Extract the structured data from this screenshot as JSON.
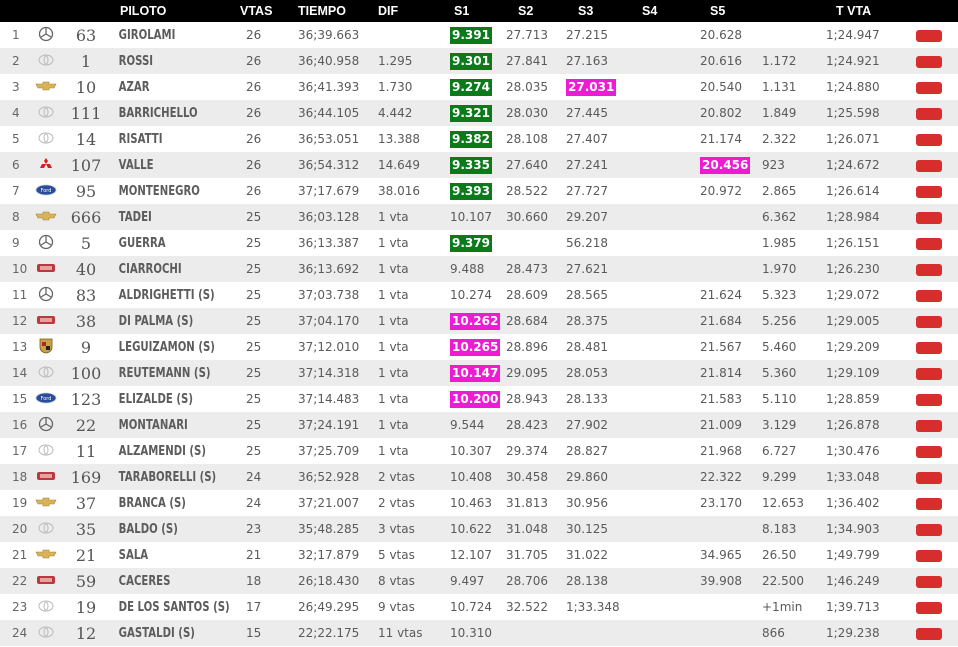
{
  "table": {
    "headers": {
      "piloto": "PILOTO",
      "vtas": "VTAS",
      "tiempo": "TIEMPO",
      "dif": "DIF",
      "s1": "S1",
      "s2": "S2",
      "s3": "S3",
      "s4": "S4",
      "s5": "S5",
      "tvta": "T VTA"
    },
    "rows": [
      {
        "pos": "1",
        "brand": "mercedes",
        "num": "63",
        "pilot": "GIROLAMI",
        "laps": "26",
        "time": "36;39.663",
        "dif": "",
        "s1": "9.391",
        "s1_hl": "green",
        "s2": "27.713",
        "s2_hl": "",
        "s3": "27.215",
        "s3_hl": "",
        "s4": "",
        "s5": "20.628",
        "s5_hl": "",
        "gap": "",
        "tvta": "1;24.947"
      },
      {
        "pos": "2",
        "brand": "toyota",
        "num": "1",
        "pilot": "ROSSI",
        "laps": "26",
        "time": "36;40.958",
        "dif": "1.295",
        "s1": "9.301",
        "s1_hl": "green",
        "s2": "27.841",
        "s2_hl": "",
        "s3": "27.163",
        "s3_hl": "",
        "s4": "",
        "s5": "20.616",
        "s5_hl": "",
        "gap": "1.172",
        "tvta": "1;24.921"
      },
      {
        "pos": "3",
        "brand": "chevrolet",
        "num": "10",
        "pilot": "AZAR",
        "laps": "26",
        "time": "36;41.393",
        "dif": "1.730",
        "s1": "9.274",
        "s1_hl": "green",
        "s2": "28.035",
        "s2_hl": "",
        "s3": "27.031",
        "s3_hl": "pink",
        "s4": "",
        "s5": "20.540",
        "s5_hl": "",
        "gap": "1.131",
        "tvta": "1;24.880"
      },
      {
        "pos": "4",
        "brand": "toyota",
        "num": "111",
        "pilot": "BARRICHELLO",
        "laps": "26",
        "time": "36;44.105",
        "dif": "4.442",
        "s1": "9.321",
        "s1_hl": "green",
        "s2": "28.030",
        "s2_hl": "",
        "s3": "27.445",
        "s3_hl": "",
        "s4": "",
        "s5": "20.802",
        "s5_hl": "",
        "gap": "1.849",
        "tvta": "1;25.598"
      },
      {
        "pos": "5",
        "brand": "toyota",
        "num": "14",
        "pilot": "RISATTI",
        "laps": "26",
        "time": "36;53.051",
        "dif": "13.388",
        "s1": "9.382",
        "s1_hl": "green",
        "s2": "28.108",
        "s2_hl": "",
        "s3": "27.407",
        "s3_hl": "",
        "s4": "",
        "s5": "21.174",
        "s5_hl": "",
        "gap": "2.322",
        "tvta": "1;26.071"
      },
      {
        "pos": "6",
        "brand": "mitsubishi",
        "num": "107",
        "pilot": "VALLE",
        "laps": "26",
        "time": "36;54.312",
        "dif": "14.649",
        "s1": "9.335",
        "s1_hl": "green",
        "s2": "27.640",
        "s2_hl": "",
        "s3": "27.241",
        "s3_hl": "",
        "s4": "",
        "s5": "20.456",
        "s5_hl": "pink",
        "gap": "923",
        "tvta": "1;24.672"
      },
      {
        "pos": "7",
        "brand": "ford",
        "num": "95",
        "pilot": "MONTENEGRO",
        "laps": "26",
        "time": "37;17.679",
        "dif": "38.016",
        "s1": "9.393",
        "s1_hl": "green",
        "s2": "28.522",
        "s2_hl": "",
        "s3": "27.727",
        "s3_hl": "",
        "s4": "",
        "s5": "20.972",
        "s5_hl": "",
        "gap": "2.865",
        "tvta": "1;26.614"
      },
      {
        "pos": "8",
        "brand": "chevrolet",
        "num": "666",
        "pilot": "TADEI",
        "laps": "25",
        "time": "36;03.128",
        "dif": "1 vta",
        "s1": "10.107",
        "s1_hl": "",
        "s2": "30.660",
        "s2_hl": "",
        "s3": "29.207",
        "s3_hl": "",
        "s4": "",
        "s5": "",
        "s5_hl": "",
        "gap": "6.362",
        "tvta": "1;28.984"
      },
      {
        "pos": "9",
        "brand": "mercedes",
        "num": "5",
        "pilot": "GUERRA",
        "laps": "25",
        "time": "36;13.387",
        "dif": "1 vta",
        "s1": "9.379",
        "s1_hl": "green",
        "s2": "",
        "s2_hl": "",
        "s3": "56.218",
        "s3_hl": "",
        "s4": "",
        "s5": "",
        "s5_hl": "",
        "gap": "1.985",
        "tvta": "1;26.151"
      },
      {
        "pos": "10",
        "brand": "dodge",
        "num": "40",
        "pilot": "CIARROCHI",
        "laps": "25",
        "time": "36;13.692",
        "dif": "1 vta",
        "s1": "9.488",
        "s1_hl": "",
        "s2": "28.473",
        "s2_hl": "",
        "s3": "27.621",
        "s3_hl": "",
        "s4": "",
        "s5": "",
        "s5_hl": "",
        "gap": "1.970",
        "tvta": "1;26.230"
      },
      {
        "pos": "11",
        "brand": "mercedes",
        "num": "83",
        "pilot": "ALDRIGHETTI (S)",
        "laps": "25",
        "time": "37;03.738",
        "dif": "1 vta",
        "s1": "10.274",
        "s1_hl": "",
        "s2": "28.609",
        "s2_hl": "",
        "s3": "28.565",
        "s3_hl": "",
        "s4": "",
        "s5": "21.624",
        "s5_hl": "",
        "gap": "5.323",
        "tvta": "1;29.072"
      },
      {
        "pos": "12",
        "brand": "dodge",
        "num": "38",
        "pilot": "DI PALMA (S)",
        "laps": "25",
        "time": "37;04.170",
        "dif": "1 vta",
        "s1": "10.262",
        "s1_hl": "pink",
        "s2": "28.684",
        "s2_hl": "",
        "s3": "28.375",
        "s3_hl": "",
        "s4": "",
        "s5": "21.684",
        "s5_hl": "",
        "gap": "5.256",
        "tvta": "1;29.005"
      },
      {
        "pos": "13",
        "brand": "porsche",
        "num": "9",
        "pilot": "LEGUIZAMON (S)",
        "laps": "25",
        "time": "37;12.010",
        "dif": "1 vta",
        "s1": "10.265",
        "s1_hl": "pink",
        "s2": "28.896",
        "s2_hl": "",
        "s3": "28.481",
        "s3_hl": "",
        "s4": "",
        "s5": "21.567",
        "s5_hl": "",
        "gap": "5.460",
        "tvta": "1;29.209"
      },
      {
        "pos": "14",
        "brand": "toyota",
        "num": "100",
        "pilot": "REUTEMANN (S)",
        "laps": "25",
        "time": "37;14.318",
        "dif": "1 vta",
        "s1": "10.147",
        "s1_hl": "pink",
        "s2": "29.095",
        "s2_hl": "",
        "s3": "28.053",
        "s3_hl": "",
        "s4": "",
        "s5": "21.814",
        "s5_hl": "",
        "gap": "5.360",
        "tvta": "1;29.109"
      },
      {
        "pos": "15",
        "brand": "ford",
        "num": "123",
        "pilot": "ELIZALDE (S)",
        "laps": "25",
        "time": "37;14.483",
        "dif": "1 vta",
        "s1": "10.200",
        "s1_hl": "pink",
        "s2": "28.943",
        "s2_hl": "",
        "s3": "28.133",
        "s3_hl": "",
        "s4": "",
        "s5": "21.583",
        "s5_hl": "",
        "gap": "5.110",
        "tvta": "1;28.859"
      },
      {
        "pos": "16",
        "brand": "mercedes",
        "num": "22",
        "pilot": "MONTANARI",
        "laps": "25",
        "time": "37;24.191",
        "dif": "1 vta",
        "s1": "9.544",
        "s1_hl": "",
        "s2": "28.423",
        "s2_hl": "",
        "s3": "27.902",
        "s3_hl": "",
        "s4": "",
        "s5": "21.009",
        "s5_hl": "",
        "gap": "3.129",
        "tvta": "1;26.878"
      },
      {
        "pos": "17",
        "brand": "toyota",
        "num": "11",
        "pilot": "ALZAMENDI (S)",
        "laps": "25",
        "time": "37;25.709",
        "dif": "1 vta",
        "s1": "10.307",
        "s1_hl": "",
        "s2": "29.374",
        "s2_hl": "",
        "s3": "28.827",
        "s3_hl": "",
        "s4": "",
        "s5": "21.968",
        "s5_hl": "",
        "gap": "6.727",
        "tvta": "1;30.476"
      },
      {
        "pos": "18",
        "brand": "dodge",
        "num": "169",
        "pilot": "TARABORELLI (S)",
        "laps": "24",
        "time": "36;52.928",
        "dif": "2 vtas",
        "s1": "10.408",
        "s1_hl": "",
        "s2": "30.458",
        "s2_hl": "",
        "s3": "29.860",
        "s3_hl": "",
        "s4": "",
        "s5": "22.322",
        "s5_hl": "",
        "gap": "9.299",
        "tvta": "1;33.048"
      },
      {
        "pos": "19",
        "brand": "chevrolet",
        "num": "37",
        "pilot": "BRANCA (S)",
        "laps": "24",
        "time": "37;21.007",
        "dif": "2 vtas",
        "s1": "10.463",
        "s1_hl": "",
        "s2": "31.813",
        "s2_hl": "",
        "s3": "30.956",
        "s3_hl": "",
        "s4": "",
        "s5": "23.170",
        "s5_hl": "",
        "gap": "12.653",
        "tvta": "1;36.402"
      },
      {
        "pos": "20",
        "brand": "toyota",
        "num": "35",
        "pilot": "BALDO (S)",
        "laps": "23",
        "time": "35;48.285",
        "dif": "3 vtas",
        "s1": "10.622",
        "s1_hl": "",
        "s2": "31.048",
        "s2_hl": "",
        "s3": "30.125",
        "s3_hl": "",
        "s4": "",
        "s5": "",
        "s5_hl": "",
        "gap": "8.183",
        "tvta": "1;34.903"
      },
      {
        "pos": "21",
        "brand": "chevrolet",
        "num": "21",
        "pilot": "SALA",
        "laps": "21",
        "time": "32;17.879",
        "dif": "5 vtas",
        "s1": "12.107",
        "s1_hl": "",
        "s2": "31.705",
        "s2_hl": "",
        "s3": "31.022",
        "s3_hl": "",
        "s4": "",
        "s5": "34.965",
        "s5_hl": "",
        "gap": "26.50",
        "tvta": "1;49.799"
      },
      {
        "pos": "22",
        "brand": "dodge",
        "num": "59",
        "pilot": "CACERES",
        "laps": "18",
        "time": "26;18.430",
        "dif": "8 vtas",
        "s1": "9.497",
        "s1_hl": "",
        "s2": "28.706",
        "s2_hl": "",
        "s3": "28.138",
        "s3_hl": "",
        "s4": "",
        "s5": "39.908",
        "s5_hl": "",
        "gap": "22.500",
        "tvta": "1;46.249"
      },
      {
        "pos": "23",
        "brand": "toyota",
        "num": "19",
        "pilot": "DE LOS SANTOS (S)",
        "laps": "17",
        "time": "26;49.295",
        "dif": "9 vtas",
        "s1": "10.724",
        "s1_hl": "",
        "s2": "32.522",
        "s2_hl": "",
        "s3": "1;33.348",
        "s3_hl": "",
        "s4": "",
        "s5": "",
        "s5_hl": "",
        "gap": "+1min",
        "tvta": "1;39.713"
      },
      {
        "pos": "24",
        "brand": "toyota",
        "num": "12",
        "pilot": "GASTALDI (S)",
        "laps": "15",
        "time": "22;22.175",
        "dif": "11 vtas",
        "s1": "10.310",
        "s1_hl": "",
        "s2": "",
        "s2_hl": "",
        "s3": "",
        "s3_hl": "",
        "s4": "",
        "s5": "",
        "s5_hl": "",
        "gap": "866",
        "tvta": "1;29.238"
      }
    ]
  },
  "colors": {
    "header_bg": "#000000",
    "row_alt": "#ececec",
    "green_highlight": "#0a7a1a",
    "pink_highlight": "#ee1bd4",
    "flag_red": "#d72d2d"
  },
  "icons": {
    "mercedes": "mercedes-logo-icon",
    "toyota": "toyota-logo-icon",
    "chevrolet": "chevrolet-logo-icon",
    "mitsubishi": "mitsubishi-logo-icon",
    "ford": "ford-logo-icon",
    "dodge": "dodge-logo-icon",
    "porsche": "porsche-logo-icon",
    "flag": "red-flag-icon"
  }
}
